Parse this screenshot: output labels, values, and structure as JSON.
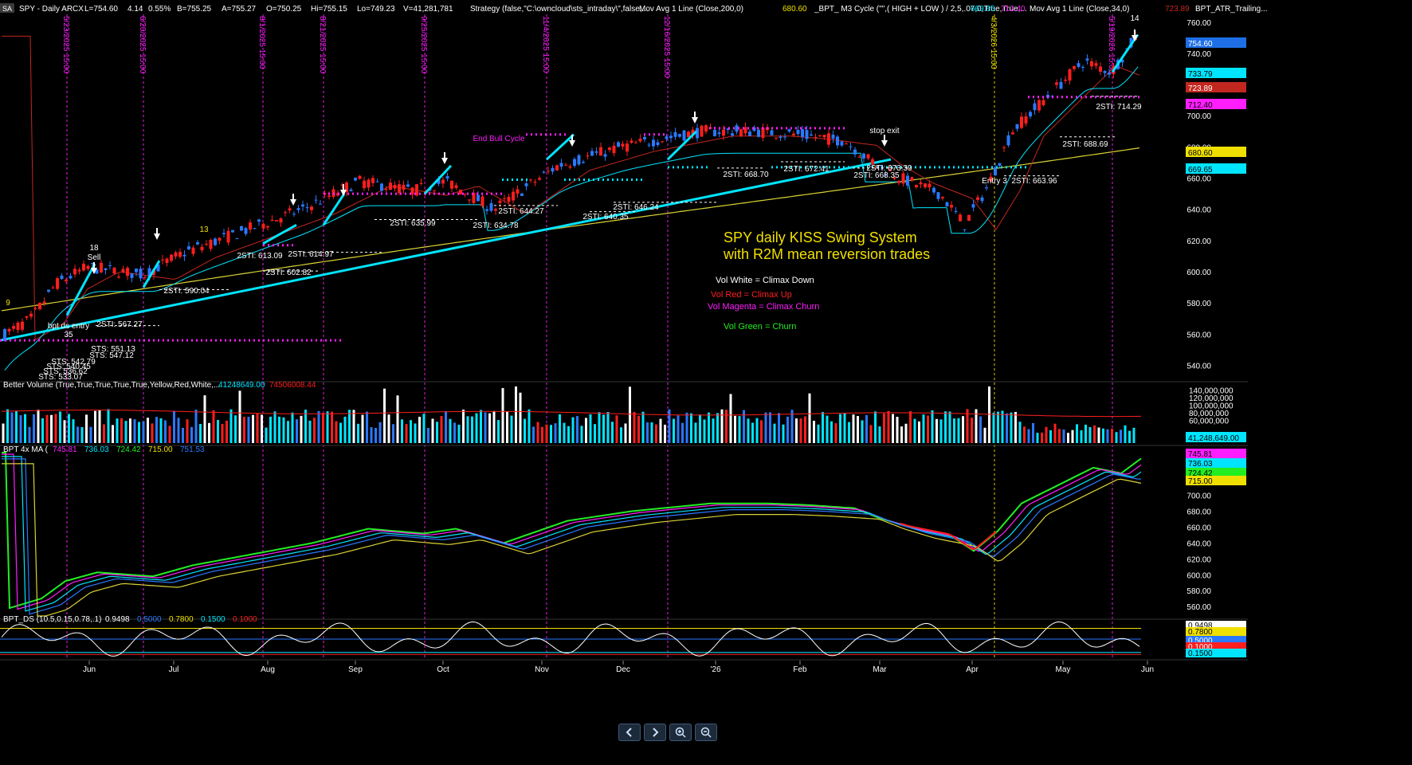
{
  "colors": {
    "background": "#000000",
    "candle_up": "#2a78ff",
    "candle_down": "#ff1e1e",
    "sts_band": "#00e5ff",
    "ma200": "#d9d235",
    "ma34": "#c2271f",
    "trend_line": "#00e5ff",
    "signal_magenta": "#ff1eff",
    "axis_text": "#ffffff",
    "grid_dotted": "#ff1eff",
    "entry_dotted": "#f0e000"
  },
  "header": {
    "symbol_badge": "SA",
    "symbol_line": "SPY - Daily  ARCX",
    "last": "L=754.60",
    "change": "4.14",
    "change_pct": "0.55%",
    "bid": "B=755.25",
    "ask": "A=755.27",
    "open": "O=750.25",
    "high": "Hi=755.15",
    "low": "Lo=749.23",
    "volume": "V=41,281,781",
    "strategy": "Strategy (false,\"C:\\owncloud\\sts_intraday\\\",false,...",
    "ma200_label": "Mov Avg 1 Line (Close,200,0)",
    "ma200_value": "680.60",
    "m3_label": "_BPT_ M3 Cycle (\"\",( HIGH + LOW ) / 2,5,.07,0,True,True,...",
    "m3_val1": "669.65",
    "m3_val2": "712.40",
    "ma34_label": "Mov Avg 1 Line (Close,34,0)",
    "ma34_value": "723.89",
    "atr_label": "BPT_ATR_Trailing..."
  },
  "vlines": [
    {
      "label": "5/23/2025 15:00"
    },
    {
      "label": "6/20/2025 15:00"
    },
    {
      "label": "8/1/2025 15:00"
    },
    {
      "label": "8/21/2025 15:00"
    },
    {
      "label": "9/25/2025 15:00"
    },
    {
      "label": "11/4/2025 15:00"
    },
    {
      "label": "12/16/2025 15:00"
    },
    {
      "label": "4/3/2026 15:00"
    },
    {
      "label": "5/19/2026 15:00"
    }
  ],
  "months": [
    "Jun",
    "Jul",
    "Aug",
    "Sep",
    "Oct",
    "Nov",
    "Dec",
    "'26",
    "Feb",
    "Mar",
    "Apr",
    "May",
    "Jun"
  ],
  "price_axis": {
    "ticks": [
      "760.00",
      "740.00",
      "720.00",
      "700.00",
      "680.00",
      "660.00",
      "640.00",
      "620.00",
      "600.00",
      "580.00",
      "560.00",
      "540.00"
    ],
    "tags": [
      {
        "text": "754.60",
        "bg": "#1e6fe6",
        "fg": "#ffffff"
      },
      {
        "text": "733.79",
        "bg": "#00e5ff",
        "fg": "#000000"
      },
      {
        "text": "723.89",
        "bg": "#c2271f",
        "fg": "#ffffff"
      },
      {
        "text": "712.40",
        "bg": "#ff1eff",
        "fg": "#000000"
      },
      {
        "text": "680.60",
        "bg": "#f0e000",
        "fg": "#000000"
      },
      {
        "text": "669.65",
        "bg": "#00e5ff",
        "fg": "#000000"
      }
    ]
  },
  "chart_data": [
    {
      "type": "candlestick",
      "title": "SPY daily KISS Swing System",
      "subtitle": "with R2M mean reversion trades",
      "ylim": [
        530,
        765
      ],
      "key_levels": {
        "ma200_last": 680.6,
        "ma34_last": 723.89,
        "m3_lower": 669.65,
        "m3_upper": 712.4,
        "sts_band_last": 733.79,
        "last_close": 754.6
      },
      "legend_notes": [
        {
          "text": "Vol White = Climax Down",
          "color": "#ffffff"
        },
        {
          "text": "Vol Red = Climax Up",
          "color": "#ff2020"
        },
        {
          "text": "Vol Magenta = Climax Churn",
          "color": "#ff1eff"
        },
        {
          "text": "Vol Green = Churn",
          "color": "#22ee22"
        }
      ],
      "annotations": [
        {
          "text": "18",
          "color": "#ffffff"
        },
        {
          "text": "Sell",
          "color": "#ffffff"
        },
        {
          "text": "bpt ds entry",
          "color": "#ffffff"
        },
        {
          "text": "35",
          "color": "#ffffff"
        },
        {
          "text": "2STI: 567.27",
          "color": "#ffffff"
        },
        {
          "text": "STS: 551.13",
          "color": "#ffffff"
        },
        {
          "text": "STS: 547.12",
          "color": "#ffffff"
        },
        {
          "text": "STS: 542.79",
          "color": "#ffffff"
        },
        {
          "text": "STS: 540.45",
          "color": "#ffffff"
        },
        {
          "text": "STS: 536.62",
          "color": "#ffffff"
        },
        {
          "text": "STS: 533.07",
          "color": "#ffffff"
        },
        {
          "text": "2STI: 590.04",
          "color": "#ffffff"
        },
        {
          "text": "2STI: 613.09",
          "color": "#ffffff"
        },
        {
          "text": "2STI: 602.82",
          "color": "#ffffff"
        },
        {
          "text": "2STI: 614.97",
          "color": "#ffffff"
        },
        {
          "text": "2STI: 635.99",
          "color": "#ffffff"
        },
        {
          "text": "2STI: 634.78",
          "color": "#ffffff"
        },
        {
          "text": "2STI: 644.27",
          "color": "#ffffff"
        },
        {
          "text": "2STI: 640.35",
          "color": "#ffffff"
        },
        {
          "text": "2STI: 646.24",
          "color": "#ffffff"
        },
        {
          "text": "2STI: 668.70",
          "color": "#ffffff"
        },
        {
          "text": "2STI: 672.41",
          "color": "#ffffff"
        },
        {
          "text": "2STI: 668.35",
          "color": "#ffffff"
        },
        {
          "text": "2STI: 673.39",
          "color": "#ffffff"
        },
        {
          "text": "2STI: 663.96",
          "color": "#ffffff"
        },
        {
          "text": "2STI: 688.69",
          "color": "#ffffff"
        },
        {
          "text": "2STI: 714.29",
          "color": "#ffffff"
        },
        {
          "text": "stop exit",
          "color": "#ffffff"
        },
        {
          "text": "Entry 3",
          "color": "#ffffff"
        },
        {
          "text": "End Bull Cycle",
          "color": "#ff1eff"
        },
        {
          "text": "9",
          "color": "#f0e000"
        },
        {
          "text": "13",
          "color": "#f0e000"
        },
        {
          "text": "14",
          "color": "#ffffff"
        }
      ]
    },
    {
      "type": "bar",
      "title": "Better Volume (True,True,True,True,True,Yellow,Red,White,...",
      "series": [
        {
          "name": "41248649.00"
        },
        {
          "name": "74506008.44"
        }
      ],
      "ylim": [
        0,
        160000000
      ],
      "ticks": [
        "140,000,000",
        "120,000,000",
        "100,000,000",
        "80,000,000",
        "60,000,000"
      ],
      "last_tag": "41,248,649.00"
    },
    {
      "type": "line",
      "title": "BPT 4x MA (",
      "series": [
        {
          "name": "745.81",
          "color": "#ff1eff"
        },
        {
          "name": "736.03",
          "color": "#00e5ff"
        },
        {
          "name": "724.42",
          "color": "#22ee22"
        },
        {
          "name": "715.00",
          "color": "#f0e000"
        },
        {
          "name": "751.53",
          "color": "#2a78ff"
        }
      ],
      "ylim": [
        545,
        760
      ],
      "ticks": [
        "700.00",
        "680.00",
        "660.00",
        "640.00",
        "620.00",
        "600.00",
        "580.00",
        "560.00"
      ]
    },
    {
      "type": "line",
      "title": "BPT_DS (10.5,0.15,0.78,.1)",
      "series": [
        {
          "name": "0.9498",
          "color": "#ffffff"
        },
        {
          "name": "0.5000",
          "color": "#2a78ff"
        },
        {
          "name": "0.7800",
          "color": "#f0e000"
        },
        {
          "name": "0.1500",
          "color": "#00e5ff"
        },
        {
          "name": "0.1000",
          "color": "#ff1e1e"
        }
      ],
      "ylim": [
        0,
        1
      ]
    }
  ]
}
